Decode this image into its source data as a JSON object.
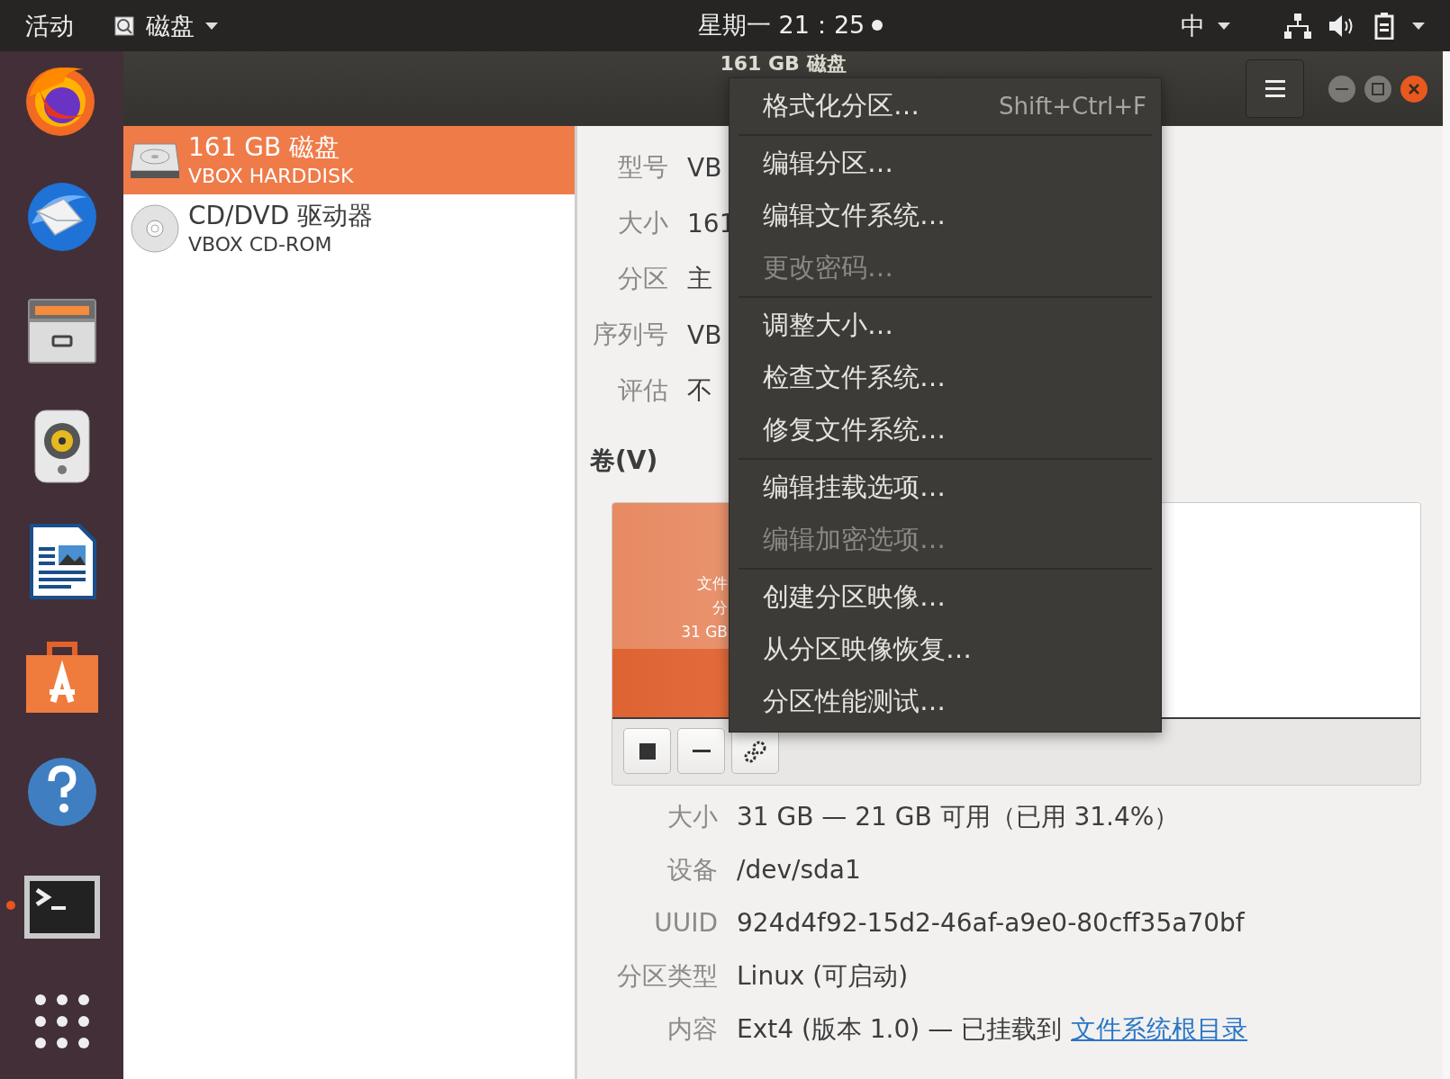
{
  "top_bar": {
    "activities": "活动",
    "app_menu": "磁盘",
    "clock": "星期一 21：25",
    "input_method": "中"
  },
  "dock": [
    {
      "kind": "browser",
      "running": false
    },
    {
      "kind": "mail",
      "running": false
    },
    {
      "kind": "files",
      "running": false
    },
    {
      "kind": "music",
      "running": false
    },
    {
      "kind": "writer",
      "running": false
    },
    {
      "kind": "software",
      "running": false
    },
    {
      "kind": "help",
      "running": false
    },
    {
      "kind": "terminal",
      "running": true
    },
    {
      "kind": "apps",
      "running": false
    }
  ],
  "window": {
    "title": "161 GB 磁盘"
  },
  "devices": [
    {
      "kind": "harddisk",
      "name": "161 GB 磁盘",
      "model": "VBOX HARDDISK",
      "selected": true
    },
    {
      "kind": "optical",
      "name": "CD/DVD 驱动器",
      "model": "VBOX CD-ROM",
      "selected": false
    }
  ],
  "drive_details": [
    {
      "label": "型号",
      "value": "VB"
    },
    {
      "label": "大小",
      "value": "161"
    },
    {
      "label": "分区",
      "value": "主"
    },
    {
      "label": "序列号",
      "value": "VB"
    },
    {
      "label": "评估",
      "value": "不"
    }
  ],
  "volumes_heading": "卷(V)",
  "partition": {
    "lines": [
      "文件",
      "分",
      "31 GB"
    ]
  },
  "volume_details": [
    {
      "label": "大小",
      "value": "31 GB — 21 GB 可用（已用 31.4%）"
    },
    {
      "label": "设备",
      "value": "/dev/sda1"
    },
    {
      "label": "UUID",
      "value": "924d4f92-15d2-46af-a9e0-80cff35a70bf"
    },
    {
      "label": "分区类型",
      "value": "Linux (可启动)"
    },
    {
      "label": "内容",
      "value": "Ext4 (版本 1.0) — 已挂载到",
      "link": "文件系统根目录"
    }
  ],
  "context_menu": {
    "sections": [
      {
        "items": [
          {
            "label": "格式化分区…",
            "shortcut": "Shift+Ctrl+F",
            "disabled": false
          }
        ]
      },
      {
        "items": [
          {
            "label": "编辑分区…",
            "disabled": false
          },
          {
            "label": "编辑文件系统…",
            "disabled": false
          },
          {
            "label": "更改密码…",
            "disabled": true
          }
        ]
      },
      {
        "items": [
          {
            "label": "调整大小…",
            "disabled": false
          },
          {
            "label": "检查文件系统…",
            "disabled": false
          },
          {
            "label": "修复文件系统…",
            "disabled": false
          }
        ]
      },
      {
        "items": [
          {
            "label": "编辑挂载选项…",
            "disabled": false
          },
          {
            "label": "编辑加密选项…",
            "disabled": true
          }
        ]
      },
      {
        "items": [
          {
            "label": "创建分区映像…",
            "disabled": false
          },
          {
            "label": "从分区映像恢复…",
            "disabled": false
          },
          {
            "label": "分区性能测试…",
            "disabled": false
          }
        ]
      }
    ]
  }
}
